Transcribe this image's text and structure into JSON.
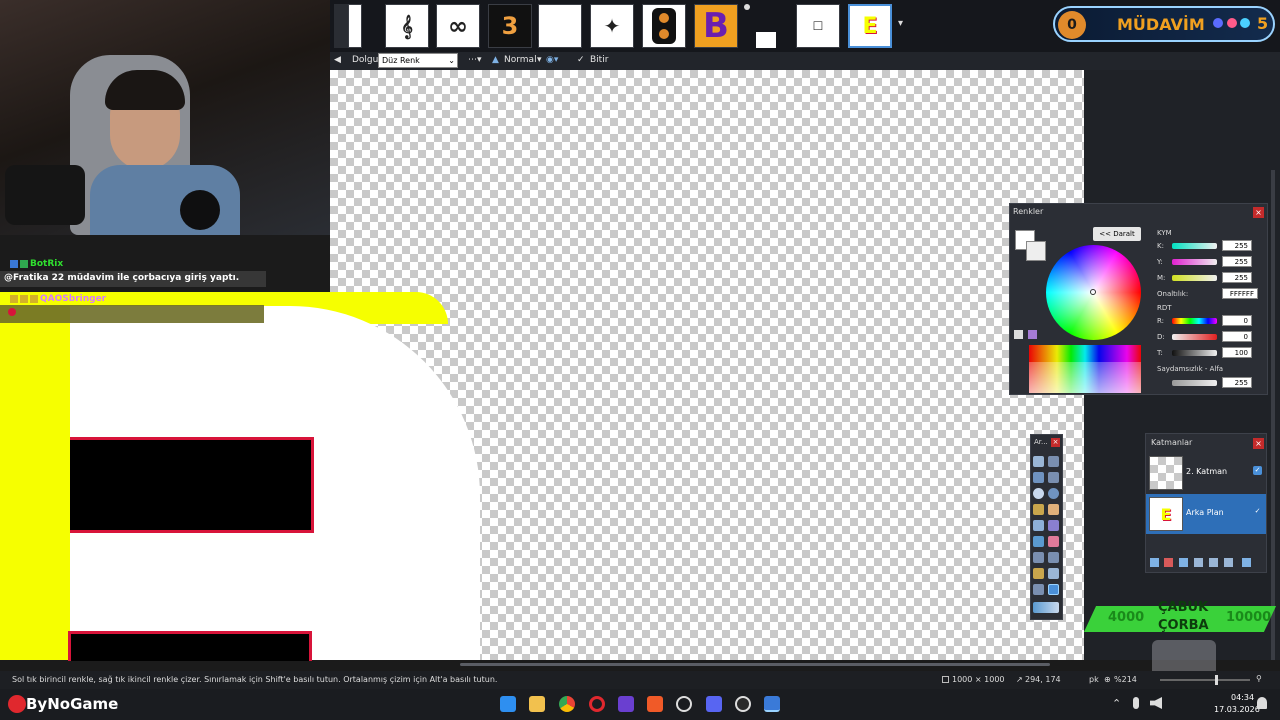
{
  "tabs": {
    "thumbnails": [
      "tab-1",
      "tab-2",
      "tab-3",
      "tab-4",
      "tab-5",
      "tab-6",
      "tab-7",
      "tab-8",
      "tab-9",
      "tab-10",
      "tab-11"
    ]
  },
  "toolbar": {
    "fill_label": "Dolgu:",
    "fill_value": "Düz Renk",
    "blend_value": "Normal",
    "finish_label": "Bitir"
  },
  "colors_window": {
    "title": "Renkler",
    "collapse_button": "<< Daralt",
    "kym_label": "KYM",
    "k_label": "K:",
    "k_value": "255",
    "y_label": "Y:",
    "y_value": "255",
    "m_label": "M:",
    "m_value": "255",
    "hex_label": "Onaltılık:",
    "hex_value": "FFFFFF",
    "rdt_label": "RDT",
    "r_label": "R:",
    "r_value": "0",
    "d_label": "D:",
    "d_value": "0",
    "t_label": "T:",
    "t_value": "100",
    "alpha_label": "Saydamsızlık - Alfa",
    "alpha_value": "255"
  },
  "tools_window": {
    "title": "Ar..."
  },
  "layers_window": {
    "title": "Katmanlar",
    "layers": [
      {
        "name": "2. Katman"
      },
      {
        "name": "Arka Plan"
      }
    ]
  },
  "status": {
    "hint": "Sol tık birincil renkle, sağ tık ikincil renkle çizer. Sınırlamak için Shift'e basılı tutun. Ortalanmış çizim için Alt'a basılı tutun.",
    "size": "1000 × 1000",
    "cursor": "294, 174",
    "unit": "pk",
    "zoom": "%214"
  },
  "taskbar": {
    "time": "04:34",
    "date": "17.03.2026"
  },
  "stream": {
    "brand": "ByNoGame",
    "chat": [
      {
        "user": "BotRix",
        "message": "@Fratika 22 müdavim ile çorbacıya giriş yaptı."
      },
      {
        "user": "QAOSbringer",
        "message": ""
      }
    ],
    "mudavim_label": "MÜDAVİM",
    "mudavim_left": "0",
    "mudavim_right": "5",
    "soup_line1": "ÇABUK",
    "soup_line2": "ÇORBA",
    "soup_left": "4000",
    "soup_right": "10000"
  },
  "colors": {
    "accent": "#4a90d9",
    "canvas_yellow": "#f6ff00",
    "canvas_red": "#d8143a",
    "soup_green": "#3ad13a"
  }
}
